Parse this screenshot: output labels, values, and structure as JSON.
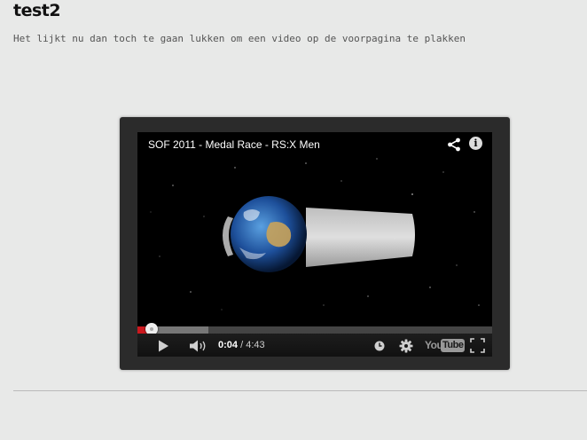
{
  "post": {
    "title": "test2",
    "text": "Het lijkt nu dan toch te gaan lukken om een video op de voorpagina te plakken"
  },
  "player": {
    "video_title": "SOF 2011 - Medal Race - RS:X Men",
    "time_current": "0:04",
    "time_separator": " / ",
    "time_total": "4:43",
    "progress": {
      "played_fraction": 0.037,
      "loaded_fraction": 0.2
    },
    "logo": {
      "you": "You",
      "tube": "Tube"
    },
    "icons": {
      "share": "share-icon",
      "info": "info-icon",
      "play": "play-icon",
      "volume": "speaker-icon",
      "watch_later": "clock-icon",
      "settings": "gear-icon",
      "fullscreen": "fullscreen-icon"
    },
    "info_glyph": "i",
    "colors": {
      "progress_played": "#cc181e",
      "frame": "#2b2b2b",
      "control_bar": "#111111"
    }
  }
}
